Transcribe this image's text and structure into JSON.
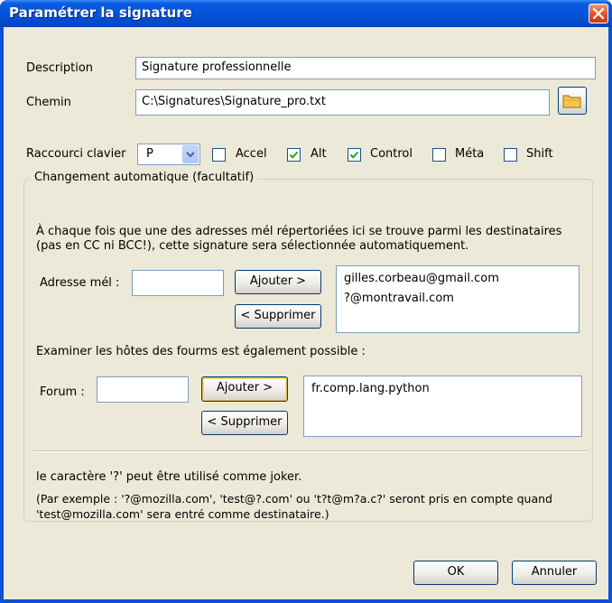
{
  "window": {
    "title": "Paramétrer la signature"
  },
  "form": {
    "description_label": "Description",
    "description_value": "Signature professionnelle",
    "path_label": "Chemin",
    "path_value": "C:\\Signatures\\Signature_pro.txt",
    "browse_icon": "folder-icon"
  },
  "shortcut": {
    "label": "Raccourci clavier",
    "key_value": "P",
    "modifiers": [
      {
        "label": "Accel",
        "checked": false
      },
      {
        "label": "Alt",
        "checked": true
      },
      {
        "label": "Control",
        "checked": true
      },
      {
        "label": "Méta",
        "checked": false
      },
      {
        "label": "Shift",
        "checked": false
      }
    ]
  },
  "auto": {
    "group_title": "Changement automatique (facultatif)",
    "intro_line1": "À chaque fois que une des adresses mél répertoriées ici se trouve parmi les destinataires",
    "intro_line2": "(pas en CC ni BCC!), cette signature sera sélectionnée automatiquement.",
    "email_label": "Adresse mél :",
    "email_input_value": "",
    "add_label": "Ajouter >",
    "remove_label": "< Supprimer",
    "email_list": [
      "gilles.corbeau@gmail.com",
      "?@montravail.com"
    ],
    "forum_intro": "Examiner les hôtes des fourms est également possible :",
    "forum_label": "Forum :",
    "forum_input_value": "",
    "forum_list": [
      "fr.comp.lang.python"
    ],
    "joker_note": "le caractère '?' peut être utilisé comme joker.",
    "example_line1": "(Par exemple : '?@mozilla.com', 'test@?.com' ou 't?t@m?a.c?' seront pris en compte quand",
    "example_line2": "'test@mozilla.com' sera entré comme destinataire.)"
  },
  "footer": {
    "ok_label": "OK",
    "cancel_label": "Annuler"
  },
  "colors": {
    "title_bar": "#0553d9",
    "dialog_bg": "#ece9d8",
    "close_button": "#e5532e"
  }
}
